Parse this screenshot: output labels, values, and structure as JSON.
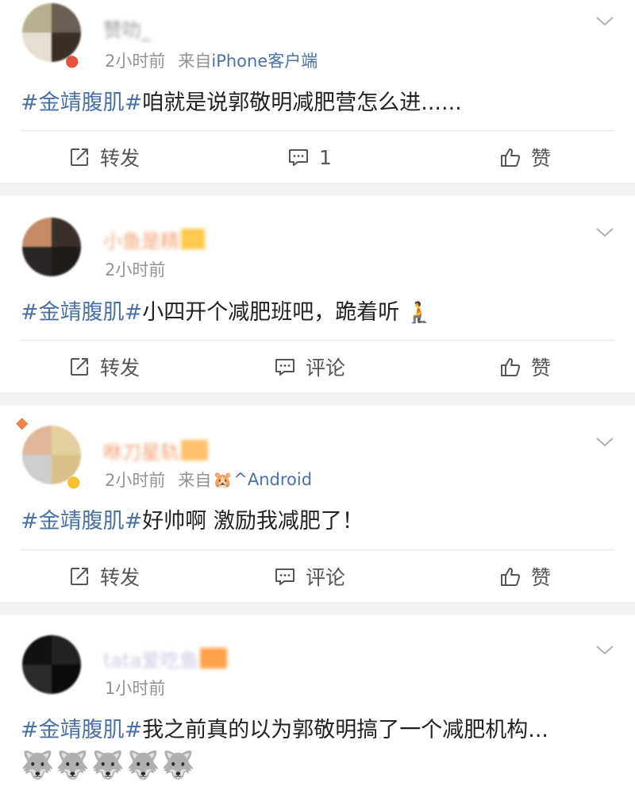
{
  "tag": "#金靖腹肌#",
  "actions": {
    "repost": "转发",
    "comment": "评论",
    "like": "赞"
  },
  "posts": [
    {
      "name_blurred": "赞叻_",
      "time": "2小时前",
      "source_prefix": "来自",
      "source": "iPhone客户端",
      "text": "咱就是说郭敬明减肥营怎么进......",
      "comment_count": "1",
      "avatar_colors": [
        "#b9b08f",
        "#6a5f52",
        "#e6dfd1",
        "#3a2e26"
      ]
    },
    {
      "name_blurred": "小鱼是精",
      "time": "2小时前",
      "text": "小四开个减肥班吧，跪着听",
      "text_emoji": "🧎",
      "avatar_colors": [
        "#c48a65",
        "#3b2f2a",
        "#2a2625",
        "#1f1b19"
      ]
    },
    {
      "name_blurred": "咻刀星轨",
      "time": "2小时前",
      "source_prefix": "来自",
      "source_emoji": "🐹",
      "source": "^Android",
      "text": "好帅啊 激励我减肥了！",
      "avatar_colors": [
        "#e0b899",
        "#e3cf9f",
        "#cdcdcd",
        "#dcc08a"
      ]
    },
    {
      "name_blurred": "tata爱吃鱼",
      "time": "1小时前",
      "text": "我之前真的以为郭敬明搞了一个减肥机构...",
      "emojis": "🐺🐺🐺🐺🐺",
      "avatar_colors": [
        "#111111",
        "#222222",
        "#2b2b2b",
        "#0c0c0c"
      ]
    }
  ],
  "colors": {
    "tag": "#4b72a4",
    "meta": "#939393",
    "separator": "#f2f2f2"
  }
}
